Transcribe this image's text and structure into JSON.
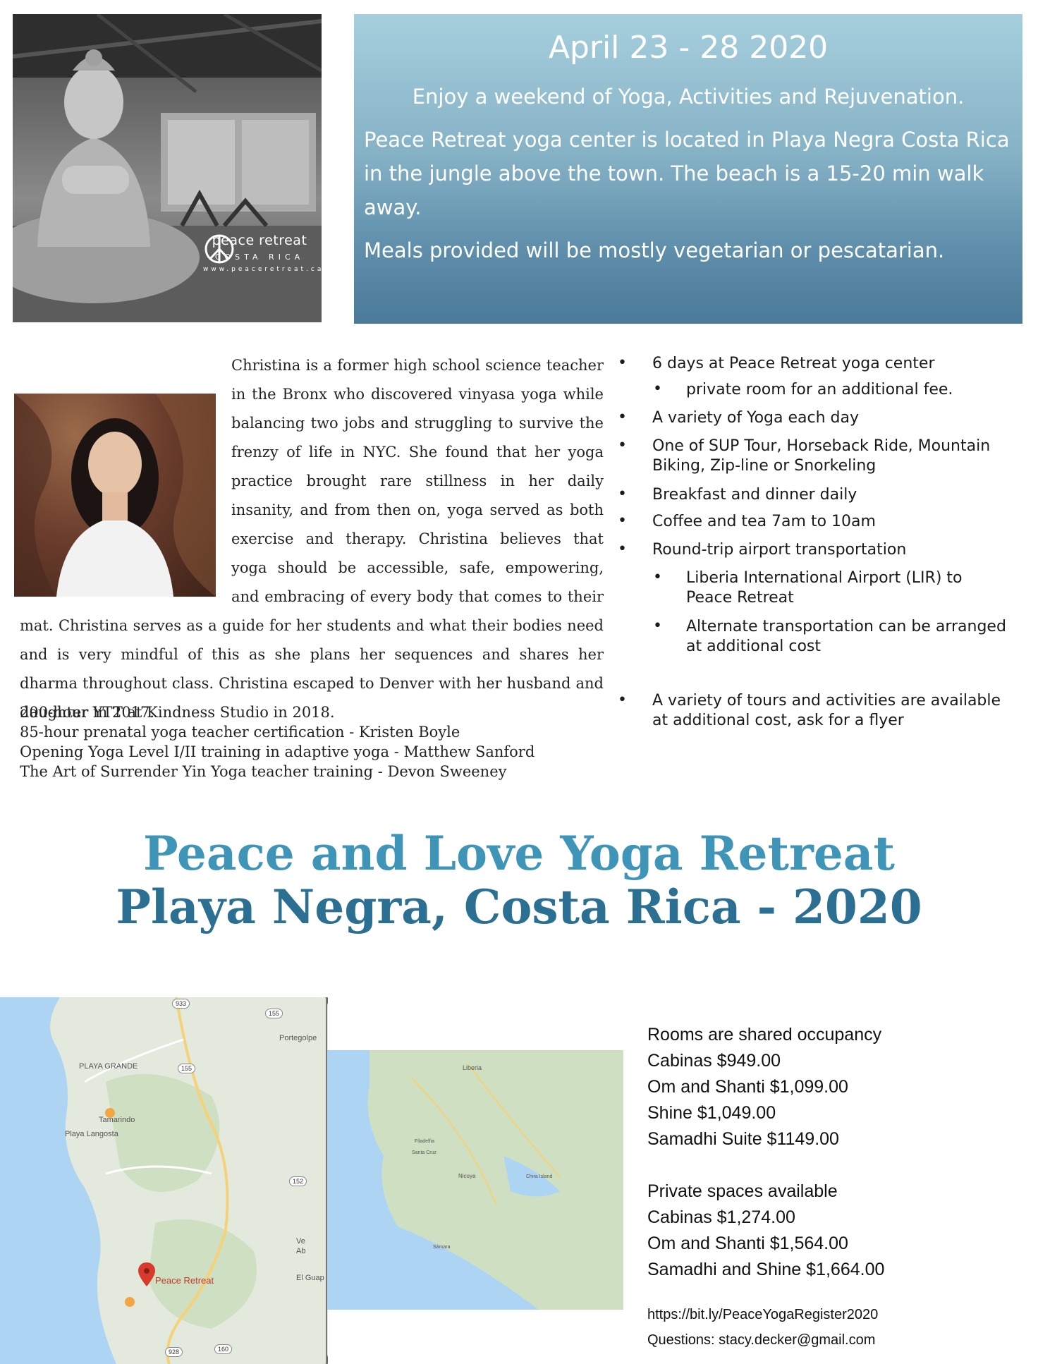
{
  "hero": {
    "logo_name": "peace retreat",
    "logo_country": "COSTA RICA",
    "logo_url": "www.peaceretreat.ca"
  },
  "info": {
    "date": "April 23 - 28 2020",
    "tagline": "Enjoy a weekend of Yoga, Activities and Rejuvenation.",
    "location": "Peace Retreat yoga center is located in Playa Negra Costa Rica in the jungle above the town. The beach is a 15-20 min walk away.",
    "meals": "Meals provided will be mostly vegetarian or pescatarian."
  },
  "bio": {
    "text": "Christina is a former high school science teacher in the Bronx who discovered vinyasa yoga while balancing two jobs and struggling to survive the frenzy of life in NYC. She found that her yoga practice brought rare stillness in her daily insanity, and from then on, yoga served as both exercise and therapy. Christina believes that yoga should be accessible, safe, empowering, and embracing of every body that comes to their mat. Christina serves as a guide for her students and what their bodies need and is very mindful of this as she plans her sequences and shares her dharma throughout class. Christina escaped to Denver with her husband and daughter in 2017.",
    "credentials": [
      "200-hour YTT at Kindness Studio in 2018.",
      "85-hour prenatal yoga teacher certification - Kristen Boyle",
      "Opening Yoga Level I/II training in adaptive yoga - Matthew Sanford",
      "The Art of Surrender Yin Yoga teacher training - Devon Sweeney"
    ]
  },
  "features": {
    "bullet": "•",
    "items": [
      "6 days at Peace Retreat yoga center",
      "private room for an additional fee.",
      "A variety of Yoga each day",
      "One of SUP Tour, Horseback Ride, Mountain Biking, Zip-line or Snorkeling",
      "Breakfast and dinner daily",
      "Coffee and tea 7am to 10am",
      "Round-trip airport transportation",
      "Liberia International Airport (LIR) to Peace Retreat",
      "Alternate transportation can be arranged at additional cost",
      "A variety of tours and activities are available at additional cost, ask for a flyer"
    ]
  },
  "title": {
    "line1": "Peace and Love Yoga Retreat",
    "line2": "Playa Negra, Costa Rica - 2020"
  },
  "map": {
    "labels": {
      "playa_grande": "PLAYA GRANDE",
      "portegolpe": "Portegolpe",
      "tamarindo": "Tamarindo",
      "playa_langosta": "Playa Langosta",
      "peace_retreat": "Peace Retreat",
      "el_guap": "El Guap",
      "ve": "Ve",
      "ab": "Ab"
    },
    "routes": {
      "r933": "933",
      "r155a": "155",
      "r155b": "155",
      "r152": "152",
      "r928": "928",
      "r160": "160"
    },
    "inset_labels": {
      "liberia": "Liberia",
      "nicoya": "Nicoya",
      "santa_cruz": "Santa Cruz",
      "filadelfia": "Filadelfia",
      "chira": "Chira Island",
      "samara": "Sámara"
    }
  },
  "pricing": {
    "shared_heading": "Rooms are shared occupancy",
    "shared": [
      "Cabinas $949.00",
      "Om and Shanti $1,099.00",
      "Shine $1,049.00",
      "Samadhi Suite $1149.00"
    ],
    "private_heading": "Private spaces available",
    "private": [
      "Cabinas $1,274.00",
      "Om and Shanti $1,564.00",
      "Samadhi and Shine $1,664.00"
    ]
  },
  "contact": {
    "register_url": "https://bit.ly/PeaceYogaRegister2020",
    "questions": "Questions: stacy.decker@gmail.com"
  },
  "colors": {
    "title_light": "#3f95b8",
    "title_dark": "#2b6f93",
    "info_box_top": "#a6cfdd",
    "info_box_bottom": "#4a7a99",
    "map_pin": "#d93a2e"
  }
}
